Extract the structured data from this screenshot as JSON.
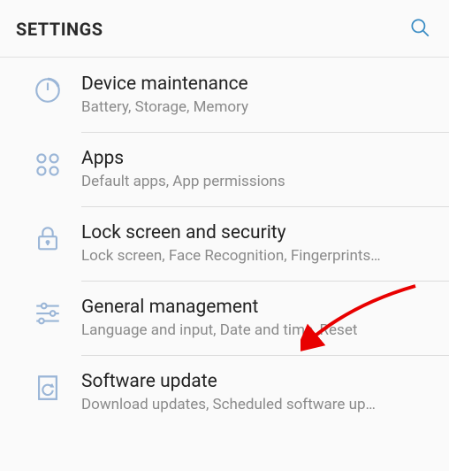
{
  "header": {
    "title": "SETTINGS"
  },
  "items": [
    {
      "title": "Device maintenance",
      "subtitle": "Battery, Storage, Memory"
    },
    {
      "title": "Apps",
      "subtitle": "Default apps, App permissions"
    },
    {
      "title": "Lock screen and security",
      "subtitle": "Lock screen, Face Recognition, Fingerprints…"
    },
    {
      "title": "General management",
      "subtitle": "Language and input, Date and time, Reset"
    },
    {
      "title": "Software update",
      "subtitle": "Download updates, Scheduled software up…"
    }
  ],
  "colors": {
    "iconStroke": "#9bb6d7",
    "accent": "#3a8cc4",
    "arrow": "#e80000"
  }
}
